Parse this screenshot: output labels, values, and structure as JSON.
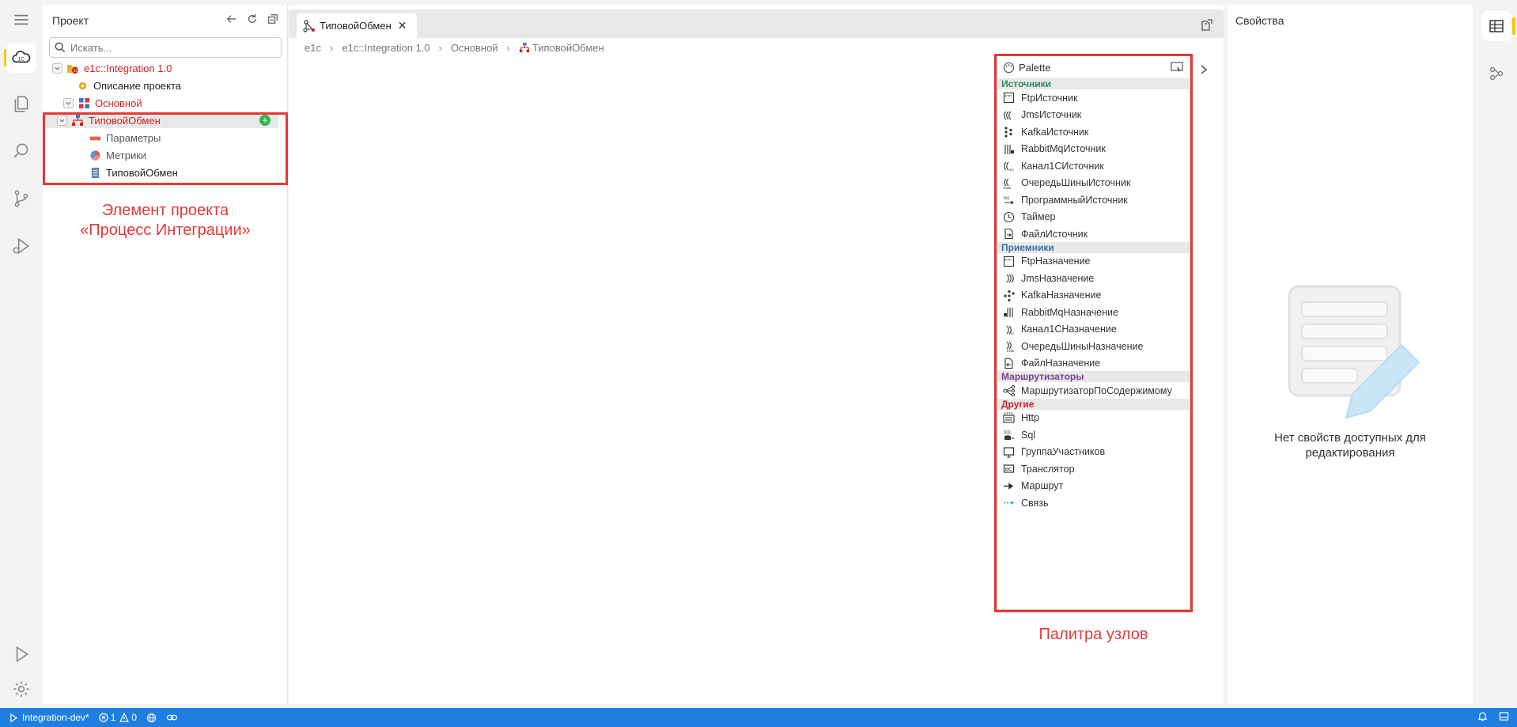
{
  "activity_bar": {
    "items": [
      "menu-icon",
      "cloud-1c-icon",
      "files-icon",
      "search-icon",
      "source-control-icon",
      "run-debug-icon"
    ],
    "bottom": [
      "run-icon",
      "settings-icon"
    ]
  },
  "project_panel": {
    "title": "Проект",
    "search_placeholder": "Искать...",
    "tree": [
      {
        "label": "e1c::Integration 1.0",
        "color": "#d21f1f"
      },
      {
        "label": "Описание проекта",
        "color": "#222222"
      },
      {
        "label": "Основной",
        "color": "#d21f1f"
      },
      {
        "label": "ТиповойОбмен",
        "color": "#d21f1f"
      },
      {
        "label": "Параметры",
        "color": "#555555"
      },
      {
        "label": "Метрики",
        "color": "#555555"
      },
      {
        "label": "ТиповойОбмен",
        "color": "#222222"
      }
    ]
  },
  "annotations": {
    "project_element_line1": "Элемент проекта",
    "project_element_line2": "«Процесс Интеграции»",
    "palette_label": "Палитра узлов",
    "color": "#e53935"
  },
  "editor": {
    "tab_label": "ТиповойОбмен",
    "breadcrumb": [
      "e1c",
      "e1c::Integration 1.0",
      "Основной",
      "ТиповойОбмен"
    ]
  },
  "palette": {
    "title": "Palette",
    "sections": [
      {
        "name": "Источники",
        "color": "#2e8b57",
        "items": [
          "FtpИсточник",
          "JmsИсточник",
          "KafkaИсточник",
          "RabbitMqИсточник",
          "Канал1СИсточник",
          "ОчередьШиныИсточник",
          "ПрограммныйИсточник",
          "Таймер",
          "ФайлИсточник"
        ]
      },
      {
        "name": "Приемники",
        "color": "#3a6ea5",
        "items": [
          "FtpНазначение",
          "JmsНазначение",
          "KafkaНазначение",
          "RabbitMqНазначение",
          "Канал1СНазначение",
          "ОчередьШиныНазначение",
          "ФайлНазначение"
        ]
      },
      {
        "name": "Маршрутизаторы",
        "color": "#7b3f91",
        "items": [
          "МаршрутизаторПоСодержимому"
        ]
      },
      {
        "name": "Другие",
        "color": "#c62828",
        "items": [
          "Http",
          "Sql",
          "ГруппаУчастников",
          "Транслятор",
          "Маршрут",
          "Связь"
        ]
      }
    ]
  },
  "properties": {
    "title": "Свойства",
    "empty_line1": "Нет свойств доступных для",
    "empty_line2": "редактирования"
  },
  "statusbar": {
    "branch": "Integration-dev*",
    "errors": "1",
    "warnings": "0",
    "color": "#1e7fe0"
  }
}
